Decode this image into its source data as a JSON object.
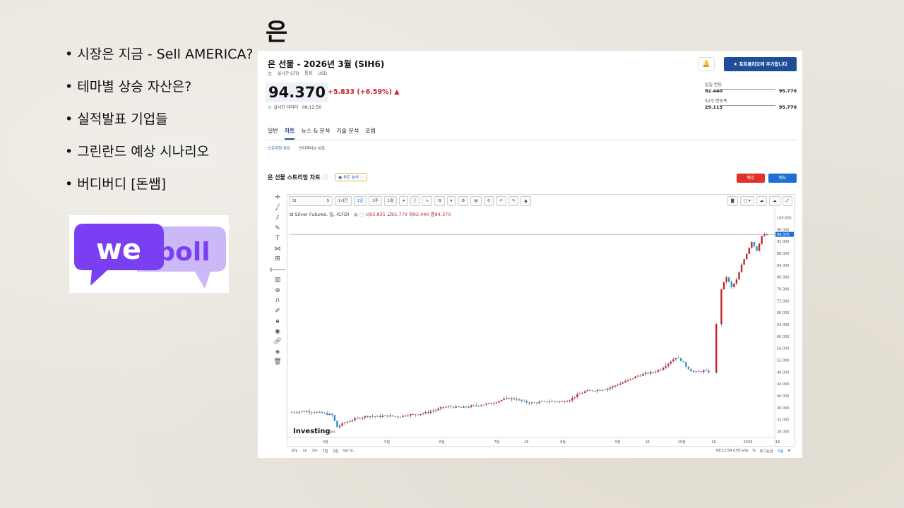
{
  "slide": {
    "title": "은",
    "bullets": [
      "시장은 지금 - Sell AMERICA?",
      "테마별 상승 자산은?",
      "실적발표 기업들",
      "그린란드 예상 시나리오",
      "버디버디 [돈쌤]"
    ],
    "logo": {
      "word1": "we",
      "word2": "poll",
      "color_purple": "#7a3ff2",
      "color_light": "#cbb8f7"
    }
  },
  "instrument": {
    "title": "은 선물 - 2026년 3월 (SIH6)",
    "type": "실시간 CFD",
    "currency_label": "통화",
    "currency": "USD",
    "alert_icon": "bell-plus-icon",
    "add_portfolio_label": "포트폴리오에 추가합니다",
    "price": "94.370",
    "change": "+5.833 (+6.59%) ▲",
    "realtime_label": "실시간 데이터 · 08:12:56",
    "day_range": {
      "label": "일일 변동",
      "low": "92.440",
      "high": "95.770"
    },
    "week52_range": {
      "label": "52주 변동폭",
      "low": "29.115",
      "high": "95.770"
    },
    "colors": {
      "up": "#c8242b",
      "down": "#2d8fd6",
      "accent": "#1f4e99"
    }
  },
  "tabs": [
    "일반",
    "차트",
    "뉴스 & 분석",
    "기술 분석",
    "포럼"
  ],
  "subtabs": [
    "스트리밍 차트",
    "인터랙티브 차트"
  ],
  "streaming": {
    "title": "은 선물 스트리밍 차트",
    "analysis_label": "차트 분석",
    "buy_label": "매수",
    "sell_label": "매도"
  },
  "chart_toolbar": {
    "symbol": "SI",
    "symbol_suffix": "S",
    "intervals": [
      "1시간",
      "1일",
      "1주",
      "1월"
    ],
    "active_interval": "1일"
  },
  "chart_legend": {
    "name": "Silver Futures, 일, (CFD)",
    "open_label": "시",
    "open": "93.835",
    "high_label": "고",
    "high": "95.770",
    "low_label": "저",
    "low": "92.440",
    "close_label": "종",
    "close": "94.370"
  },
  "bottom_bar": {
    "ranges": [
      "10y",
      "1y",
      "1m",
      "7일",
      "1일",
      "Go to..."
    ],
    "time": "08:12:54 (UTC+9)",
    "percent": "%",
    "log": "로그눈금",
    "auto": "자동"
  },
  "chart_data": {
    "type": "candlestick",
    "x_ticks": [
      "4월",
      "5월",
      "6월",
      "7월",
      "16",
      "8월",
      "9월",
      "16",
      "10월",
      "16",
      "2026",
      "16"
    ],
    "y_ticks": [
      "100.000",
      "96.000",
      "92.000",
      "88.000",
      "84.000",
      "80.000",
      "76.000",
      "72.000",
      "68.000",
      "64.000",
      "60.000",
      "56.000",
      "52.000",
      "48.000",
      "44.000",
      "40.000",
      "36.000",
      "32.000",
      "28.000"
    ],
    "ylim": [
      26,
      102
    ],
    "last_price_label": "94.370",
    "watermark": "Investing",
    "watermark_suffix": ".com",
    "close_path": [
      [
        0,
        34.5
      ],
      [
        6,
        34.8
      ],
      [
        12,
        34.2
      ],
      [
        16,
        33.5
      ],
      [
        18,
        29.5
      ],
      [
        21,
        31.0
      ],
      [
        26,
        32.5
      ],
      [
        30,
        33.2
      ],
      [
        34,
        33.0
      ],
      [
        38,
        33.3
      ],
      [
        42,
        33.0
      ],
      [
        46,
        33.6
      ],
      [
        50,
        33.8
      ],
      [
        54,
        34.5
      ],
      [
        58,
        35.5
      ],
      [
        60,
        36.2
      ],
      [
        64,
        36.3
      ],
      [
        67,
        36.0
      ],
      [
        71,
        36.5
      ],
      [
        75,
        37.0
      ],
      [
        79,
        37.5
      ],
      [
        83,
        38.6
      ],
      [
        86,
        39.2
      ],
      [
        89,
        38.8
      ],
      [
        92,
        38.0
      ],
      [
        95,
        37.6
      ],
      [
        99,
        37.9
      ],
      [
        103,
        38.2
      ],
      [
        107,
        38.0
      ],
      [
        110,
        38.7
      ],
      [
        113,
        40.3
      ],
      [
        116,
        41.5
      ],
      [
        119,
        41.8
      ],
      [
        122,
        42.0
      ],
      [
        125,
        42.5
      ],
      [
        128,
        43.5
      ],
      [
        131,
        44.5
      ],
      [
        134,
        45.6
      ],
      [
        137,
        46.8
      ],
      [
        140,
        47.5
      ],
      [
        143,
        48.0
      ],
      [
        146,
        49.0
      ],
      [
        149,
        51.0
      ],
      [
        152,
        53.0
      ],
      [
        154,
        52.0
      ],
      [
        156,
        50.0
      ],
      [
        158,
        48.5
      ],
      [
        160,
        48.0
      ],
      [
        163,
        48.4
      ],
      [
        165,
        48.0
      ],
      [
        168,
        64.0
      ],
      [
        170,
        76.0
      ],
      [
        172,
        80.0
      ],
      [
        174,
        76.5
      ],
      [
        176,
        79.0
      ],
      [
        178,
        84.0
      ],
      [
        180,
        88.0
      ],
      [
        182,
        92.0
      ],
      [
        184,
        89.0
      ],
      [
        186,
        93.8
      ],
      [
        188,
        94.3
      ]
    ]
  }
}
